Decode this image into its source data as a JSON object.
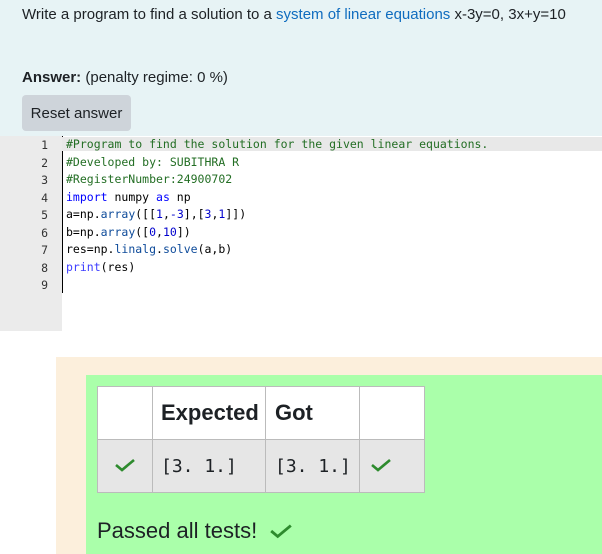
{
  "question": {
    "prefix": "Write a program to find a solution to a ",
    "link_text": "system of linear equations",
    "suffix": " x-3y=0, 3x+y=10"
  },
  "answer": {
    "label": "Answer:",
    "penalty": "(penalty regime: 0 %)",
    "reset_label": "Reset answer"
  },
  "editor": {
    "line_numbers": [
      "1",
      "2",
      "3",
      "4",
      "5",
      "6",
      "7",
      "8",
      "9"
    ],
    "lines": [
      "#Program to find the solution for the given linear equations.",
      "#Developed by: SUBITHRA R",
      "#RegisterNumber:24900702",
      "import numpy as np",
      "a=np.array([[1,-3],[3,1]])",
      "b=np.array([0,10])",
      "res=np.linalg.solve(a,b)",
      "print(res)",
      ""
    ]
  },
  "results": {
    "headers": [
      "",
      "Expected",
      "Got",
      ""
    ],
    "rows": [
      {
        "expected": "[3. 1.]",
        "got": "[3. 1.]"
      }
    ],
    "status": "Passed all tests!"
  },
  "colors": {
    "tick": "#2e8b2e",
    "pass_bg": "#aaffaa",
    "outer_bg": "#fcefdc"
  }
}
